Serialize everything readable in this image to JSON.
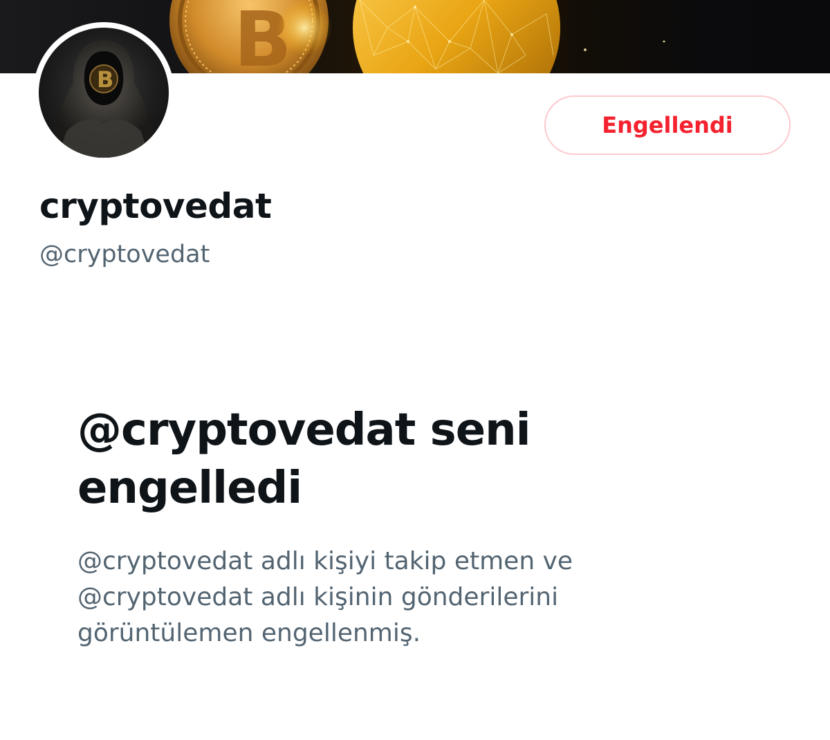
{
  "profile": {
    "display_name": "cryptovedat",
    "handle": "@cryptovedat",
    "banner_icon": "bitcoin-banner",
    "avatar_icon": "hooded-figure-bitcoin-avatar"
  },
  "actions": {
    "blocked_label": "Engellendi"
  },
  "blocked_notice": {
    "title": "@cryptovedat seni engelledi",
    "description": "@cryptovedat adlı kişiyi takip etmen ve @cryptovedat adlı kişinin gönderilerini görüntülemen engellenmiş."
  },
  "colors": {
    "blocked_red": "#f4212e",
    "blocked_border": "#fdc9ce",
    "primary_text": "#0f1419",
    "secondary_text": "#536471",
    "gold": "#e6a817"
  }
}
